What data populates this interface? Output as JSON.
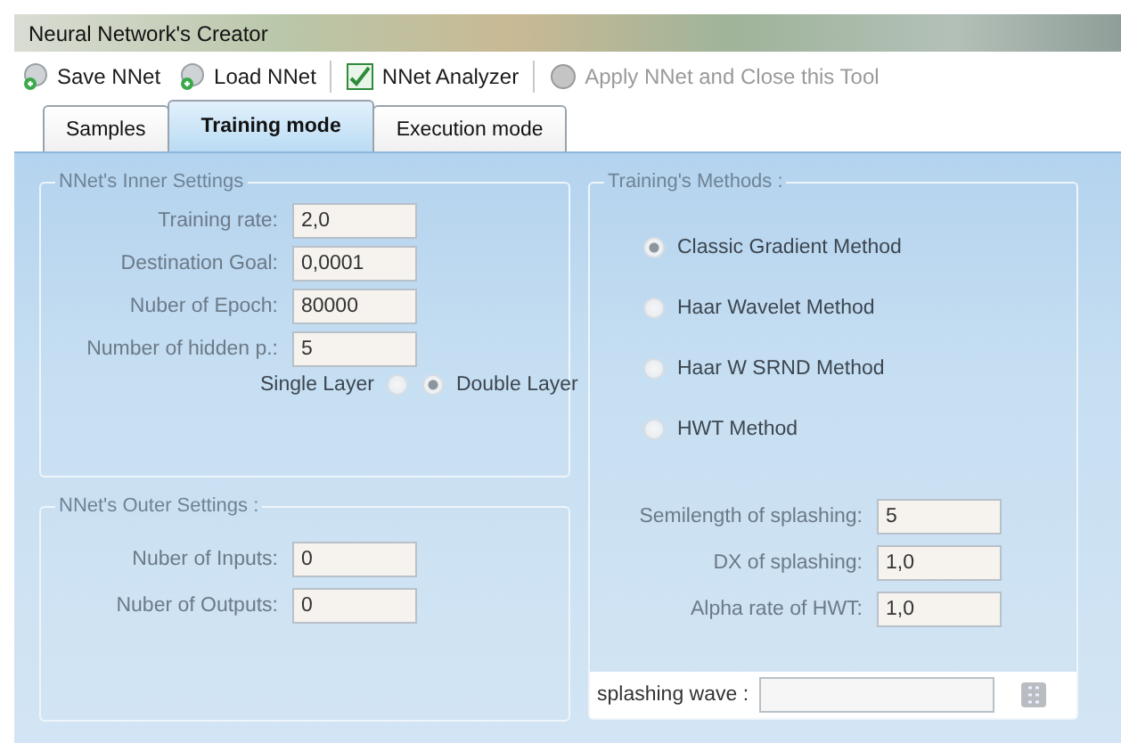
{
  "window": {
    "title": "Neural Network's Creator"
  },
  "toolbar": [
    {
      "label": "Save NNet",
      "kind": "save",
      "disabled": false
    },
    {
      "label": "Load NNet",
      "kind": "load",
      "disabled": false
    },
    {
      "label": "NNet Analyzer",
      "kind": "analyzer",
      "disabled": false
    },
    {
      "label": "Apply NNet and Close this Tool",
      "kind": "apply",
      "disabled": true
    }
  ],
  "tabs": [
    {
      "label": "Samples",
      "selected": false
    },
    {
      "label": "Training mode",
      "selected": true
    },
    {
      "label": "Execution mode",
      "selected": false
    }
  ],
  "inner_settings": {
    "legend": "NNet's Inner Settings",
    "fields": [
      {
        "label": "Training rate:",
        "value": "2,0"
      },
      {
        "label": "Destination Goal:",
        "value": "0,0001"
      },
      {
        "label": "Nuber of Epoch:",
        "value": "80000"
      },
      {
        "label": "Number of hidden p.:",
        "value": "5"
      }
    ],
    "layers": [
      {
        "label": "Single Layer",
        "selected": false
      },
      {
        "label": "Double Layer",
        "selected": true
      }
    ]
  },
  "outer_settings": {
    "legend": "NNet's Outer Settings :",
    "fields": [
      {
        "label": "Nuber of Inputs:",
        "value": "0"
      },
      {
        "label": "Nuber of Outputs:",
        "value": "0"
      }
    ]
  },
  "training_methods": {
    "legend": "Training's Methods :",
    "methods": [
      {
        "label": "Classic Gradient Method",
        "selected": true
      },
      {
        "label": "Haar Wavelet Method",
        "selected": false
      },
      {
        "label": "Haar W SRND Method",
        "selected": false
      },
      {
        "label": "HWT Method",
        "selected": false
      }
    ],
    "fields": [
      {
        "label": "Semilength of splashing:",
        "value": "5"
      },
      {
        "label": "DX of splashing:",
        "value": "1,0"
      },
      {
        "label": "Alpha rate of HWT:",
        "value": "1,0"
      }
    ],
    "splashing_wave": {
      "label": "splashing wave :"
    }
  }
}
